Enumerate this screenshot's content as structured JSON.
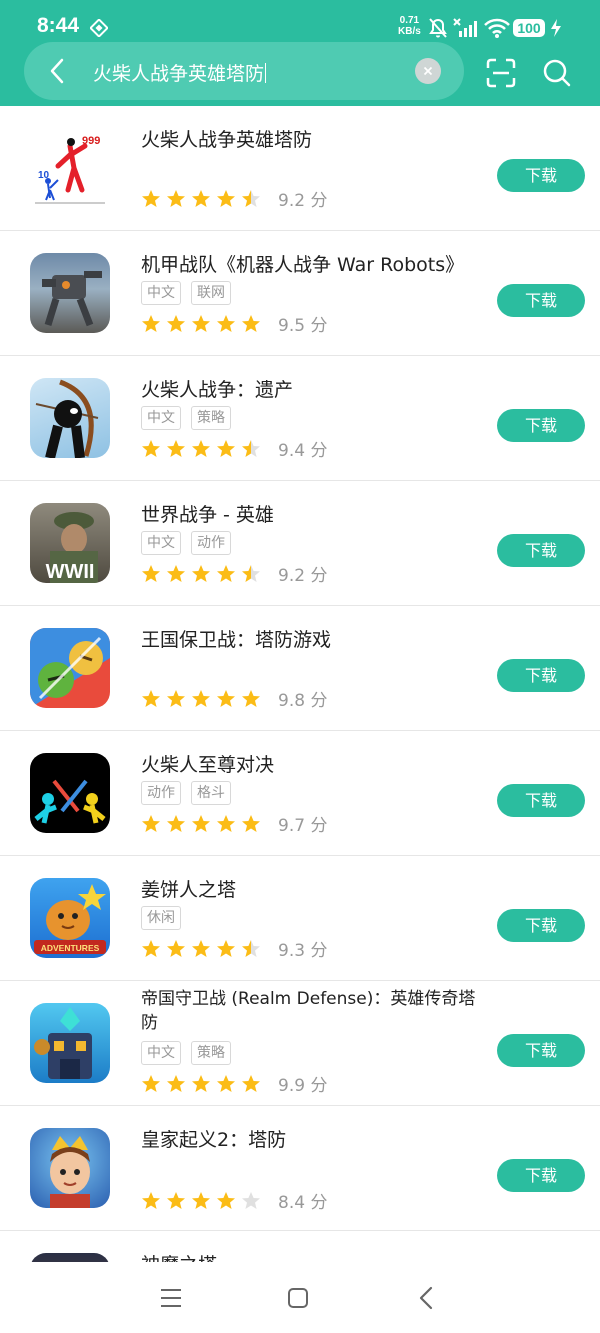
{
  "status": {
    "time": "8:44",
    "net_speed_value": "0.71",
    "net_speed_unit": "KB/s",
    "battery": "100"
  },
  "search": {
    "query": "火柴人战争英雄塔防"
  },
  "apps": [
    {
      "name": "火柴人战争英雄塔防",
      "name2": "",
      "tags": [],
      "rating_stars": 4.5,
      "score": "9.2 分",
      "download_label": "下载"
    },
    {
      "name": "机甲战队《机器人战争 War Robots》",
      "name2": "",
      "tags": [
        "中文",
        "联网"
      ],
      "rating_stars": 5,
      "score": "9.5 分",
      "download_label": "下载"
    },
    {
      "name": "火柴人战争：遗产",
      "name2": "",
      "tags": [
        "中文",
        "策略"
      ],
      "rating_stars": 4.5,
      "score": "9.4 分",
      "download_label": "下载"
    },
    {
      "name": "世界战争 - 英雄",
      "name2": "",
      "tags": [
        "中文",
        "动作"
      ],
      "rating_stars": 4.5,
      "score": "9.2 分",
      "download_label": "下载",
      "icon_text": "WWII"
    },
    {
      "name": "王国保卫战：塔防游戏",
      "name2": "",
      "tags": [],
      "rating_stars": 5,
      "score": "9.8 分",
      "download_label": "下载"
    },
    {
      "name": "火柴人至尊对决",
      "name2": "",
      "tags": [
        "动作",
        "格斗"
      ],
      "rating_stars": 5,
      "score": "9.7 分",
      "download_label": "下载"
    },
    {
      "name": "姜饼人之塔",
      "name2": "",
      "tags": [
        "休闲"
      ],
      "rating_stars": 4.5,
      "score": "9.3 分",
      "download_label": "下载",
      "icon_text": "ADVENTURES"
    },
    {
      "name": "帝国守卫战 (Realm Defense)：英雄传奇塔",
      "name2": "防",
      "tags": [
        "中文",
        "策略"
      ],
      "rating_stars": 5,
      "score": "9.9 分",
      "download_label": "下载"
    },
    {
      "name": "皇家起义2：塔防",
      "name2": "",
      "tags": [],
      "rating_stars": 4,
      "score": "8.4 分",
      "download_label": "下载"
    },
    {
      "name": "神魔之塔",
      "name2": "",
      "tags": [],
      "rating_stars": 0,
      "score": "",
      "download_label": ""
    }
  ],
  "colors": {
    "accent": "#2bbd9f",
    "star": "#fbbc16",
    "star_empty": "#e0e0e0"
  }
}
